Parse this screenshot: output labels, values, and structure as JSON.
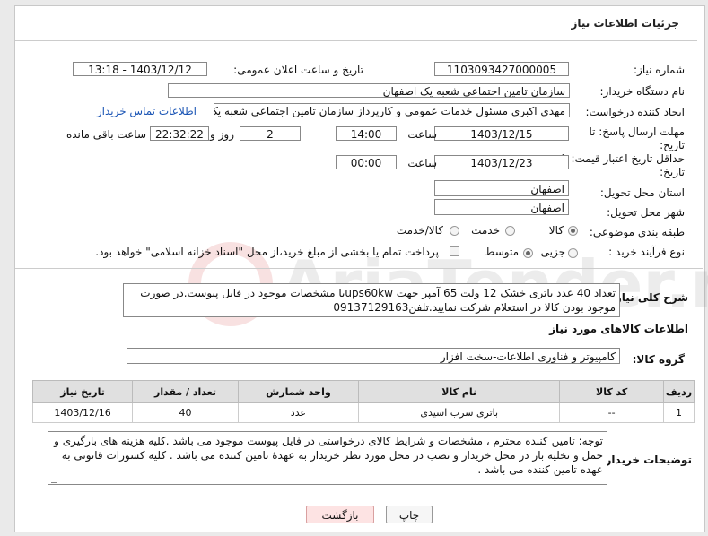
{
  "header": {
    "title": "جزئیات اطلاعات نیاز"
  },
  "form": {
    "need_number_label": "شماره نیاز:",
    "need_number": "1103093427000005",
    "announce_label": "تاریخ و ساعت اعلان عمومی:",
    "announce_value": "1403/12/12 - 13:18",
    "buyer_org_label": "نام دستگاه خریدار:",
    "buyer_org": "سازمان تامین اجتماعی شعبه یک اصفهان",
    "requester_label": "ایجاد کننده درخواست:",
    "requester": "مهدی اکبری مسئول خدمات عمومی و کارپرداز سازمان تامین اجتماعی شعبه یک اصفهان",
    "contact_link": "اطلاعات تماس خریدار",
    "reply_deadline_label_1": "مهلت ارسال پاسخ: تا",
    "reply_deadline_label_2": "تاریخ:",
    "reply_date": "1403/12/15",
    "time_label": "ساعت",
    "reply_time": "14:00",
    "days_value": "2",
    "days_label": "روز و",
    "remaining_time": "22:32:22",
    "remaining_label": "ساعت باقی مانده",
    "price_deadline_label_1": "حداقل تاریخ اعتبار قیمت: تا",
    "price_deadline_label_2": "تاریخ:",
    "price_date": "1403/12/23",
    "price_time": "00:00",
    "province_label": "استان محل تحویل:",
    "province": "اصفهان",
    "city_label": "شهر محل تحویل:",
    "city": "اصفهان",
    "category_label": "طبقه بندی موضوعی:",
    "category_options": [
      "کالا",
      "خدمت",
      "کالا/خدمت"
    ],
    "process_label": "نوع فرآیند خرید :",
    "process_options": [
      "جزیی",
      "متوسط"
    ],
    "payment_note": "پرداخت تمام یا بخشی از مبلغ خرید،از محل \"اسناد خزانه اسلامی\" خواهد بود."
  },
  "description": {
    "label": "شرح کلی نیاز:",
    "text": "تعداد 40 عدد باتری خشک 12 ولت 65 آمپر جهت ups60kwبا مشخصات موجود در فایل پیوست.در صورت موجود بودن کالا در استعلام شرکت نمایید.تلفن09137129163"
  },
  "goods": {
    "section_title": "اطلاعات کالاهای مورد نیاز",
    "group_label": "گروه کالا:",
    "group_value": "کامپیوتر و فناوری اطلاعات-سخت افزار",
    "columns": [
      "ردیف",
      "کد کالا",
      "نام کالا",
      "واحد شمارش",
      "تعداد / مقدار",
      "تاریخ نیاز"
    ],
    "rows": [
      [
        "1",
        "--",
        "باتری سرب اسیدی",
        "عدد",
        "40",
        "1403/12/16"
      ]
    ]
  },
  "buyer_notes": {
    "label": "توضیحات خریدار:",
    "text": "توجه: تامین کننده محترم ، مشخصات و شرایط کالای درخواستی در فایل پیوست موجود می باشد .کلیه هزینه های بارگیری و حمل و تخلیه بار در محل خریدار و نصب در محل مورد نظر خریدار به عهدۀ تامین کننده می باشد . کلیه کسورات قانونی به عهده تامین کننده می باشد ."
  },
  "buttons": {
    "print": "چاپ",
    "back": "بازگشت"
  },
  "watermark_text": "AriaTender.neT",
  "colors": {
    "link": "#1b55b5",
    "back_button": "#fde3e3",
    "table_header": "#e0e0e0"
  }
}
